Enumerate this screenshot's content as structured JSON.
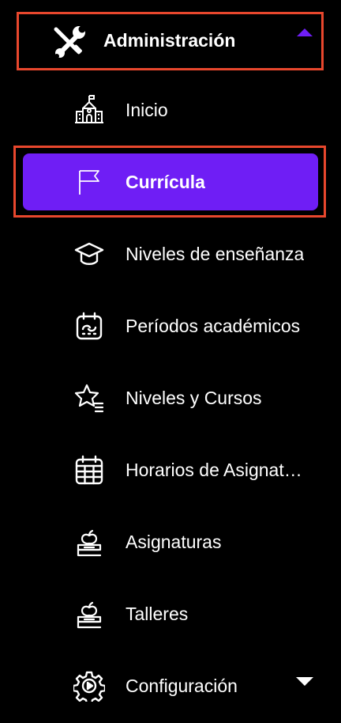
{
  "header": {
    "label": "Administración",
    "icon": "wrench-screwdriver-icon",
    "expanded": true
  },
  "colors": {
    "background": "#000000",
    "text": "#ffffff",
    "active_background": "#6f1ef5",
    "accent_caret": "#6f1ef5",
    "highlight_outline": "#e8472d"
  },
  "menu": {
    "items": [
      {
        "label": "Inicio",
        "icon": "school-building-icon"
      },
      {
        "label": "Currícula",
        "icon": "flag-icon",
        "active": true
      },
      {
        "label": "Niveles de enseñanza",
        "icon": "graduation-cap-icon"
      },
      {
        "label": "Períodos académicos",
        "icon": "calendar-icon"
      },
      {
        "label": "Niveles y Cursos",
        "icon": "star-list-icon"
      },
      {
        "label": "Horarios de Asignat…",
        "icon": "calendar-grid-icon"
      },
      {
        "label": "Asignaturas",
        "icon": "books-apple-icon"
      },
      {
        "label": "Talleres",
        "icon": "books-apple-icon"
      },
      {
        "label": "Configuración",
        "icon": "gear-icon",
        "expandable": true
      }
    ]
  }
}
